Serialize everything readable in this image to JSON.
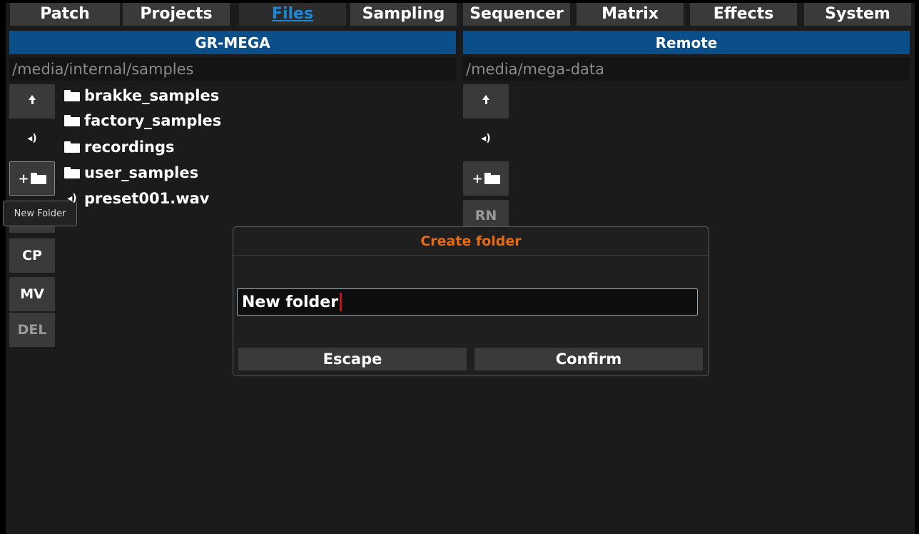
{
  "tabs": [
    {
      "label": "Patch",
      "active": false
    },
    {
      "label": "Projects",
      "active": false
    },
    {
      "label": "Files",
      "active": true
    },
    {
      "label": "Sampling",
      "active": false
    },
    {
      "label": "Sequencer",
      "active": false
    },
    {
      "label": "Matrix",
      "active": false
    },
    {
      "label": "Effects",
      "active": false
    },
    {
      "label": "System",
      "active": false
    }
  ],
  "left_panel": {
    "title": "GR-MEGA",
    "path": "/media/internal/samples",
    "buttons": {
      "up": "up-arrow-icon",
      "play": "speaker-icon",
      "new_folder_plus": "+",
      "cp": "CP",
      "mv": "MV",
      "del": "DEL"
    },
    "tooltip": "New Folder",
    "items": [
      {
        "name": "brakke_samples",
        "type": "folder"
      },
      {
        "name": "factory_samples",
        "type": "folder"
      },
      {
        "name": "recordings",
        "type": "folder"
      },
      {
        "name": "user_samples",
        "type": "folder"
      },
      {
        "name": "preset001.wav",
        "type": "audio"
      }
    ]
  },
  "right_panel": {
    "title": "Remote",
    "path": "/media/mega-data",
    "buttons": {
      "new_folder_plus": "+",
      "rn": "RN"
    }
  },
  "dialog": {
    "title": "Create folder",
    "input_value": "New folder",
    "escape_label": "Escape",
    "confirm_label": "Confirm"
  },
  "colors": {
    "panel_header": "#0b4f8a",
    "active_tab_text": "#1e88d6",
    "dialog_title": "#e86a10",
    "caret": "#c0141a"
  }
}
